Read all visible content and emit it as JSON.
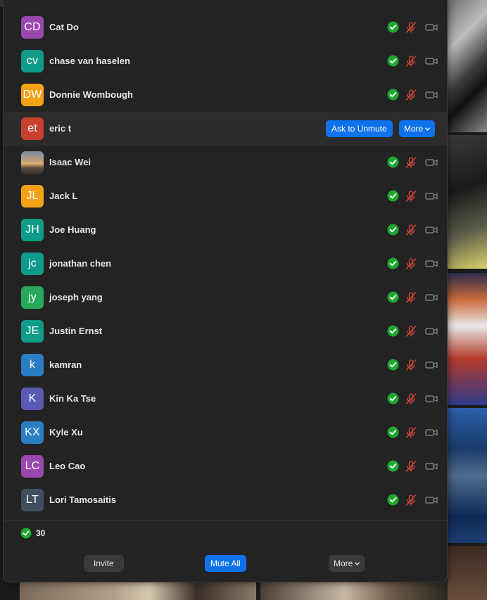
{
  "participants": [
    {
      "initials": "CD",
      "name": "Cat Do",
      "color": "#9a48b0"
    },
    {
      "initials": "cv",
      "name": "chase van haselen",
      "color": "#0e9c88"
    },
    {
      "initials": "DW",
      "name": "Donnie Wombough",
      "color": "#f5a116"
    },
    {
      "initials": "et",
      "name": "eric t",
      "color": "#c8402e"
    },
    {
      "initials": "",
      "name": "Isaac Wei",
      "color": "#777777"
    },
    {
      "initials": "JL",
      "name": "Jack L",
      "color": "#f5a116"
    },
    {
      "initials": "JH",
      "name": "Joe Huang",
      "color": "#0e9c88"
    },
    {
      "initials": "jc",
      "name": "jonathan chen",
      "color": "#0e9c88"
    },
    {
      "initials": "jy",
      "name": "joseph yang",
      "color": "#27a85a"
    },
    {
      "initials": "JE",
      "name": "Justin Ernst",
      "color": "#0e9c88"
    },
    {
      "initials": "k",
      "name": "kamran",
      "color": "#2a7fc4"
    },
    {
      "initials": "K",
      "name": "Kin Ka Tse",
      "color": "#5a5ab4"
    },
    {
      "initials": "KX",
      "name": "Kyle Xu",
      "color": "#2a7fc4"
    },
    {
      "initials": "LC",
      "name": "Leo Cao",
      "color": "#9a48b0"
    },
    {
      "initials": "LT",
      "name": "Lori Tamosaitis",
      "color": "#3f4f5f"
    }
  ],
  "hover_row": {
    "ask_to_unmute_label": "Ask to Unmute",
    "more_label": "More"
  },
  "summary": {
    "count": "30"
  },
  "footer": {
    "invite_label": "Invite",
    "mute_all_label": "Mute All",
    "more_label": "More"
  },
  "colors": {
    "accent": "#0e72ed",
    "check": "#1fa82f",
    "muted_mic": "#d9463a"
  },
  "icons": {
    "status_check": "check-circle-icon",
    "muted": "mic-muted-icon",
    "video_off": "video-camera-icon",
    "dropdown": "chevron-down-icon"
  }
}
